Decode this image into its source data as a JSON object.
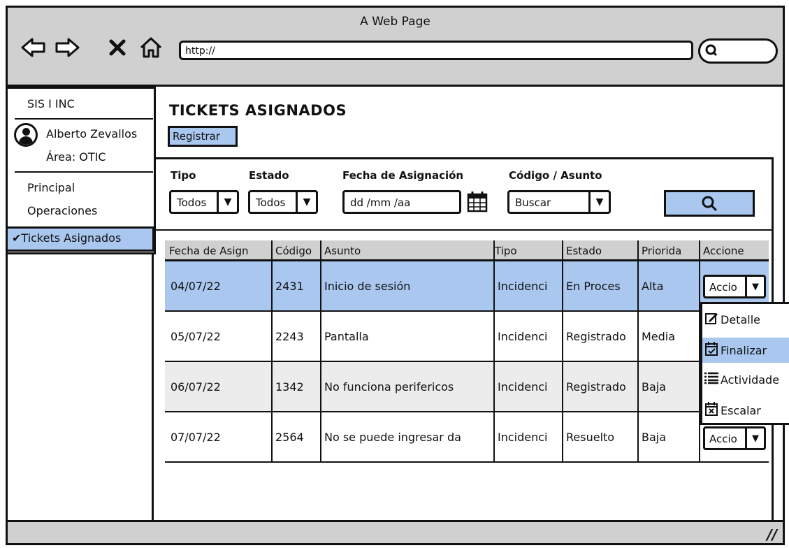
{
  "window": {
    "title": "A Web Page"
  },
  "browser": {
    "url": "http://",
    "icons": [
      "back-icon",
      "forward-icon",
      "close-icon",
      "home-icon",
      "search-icon"
    ]
  },
  "sidebar": {
    "app_name": "SIS I INC",
    "user_name": "Alberto Zevallos",
    "user_area": "Área: OTIC",
    "items": [
      {
        "label": "Principal"
      },
      {
        "label": "Operaciones"
      },
      {
        "label": "Tickets Asignados",
        "active": true
      }
    ]
  },
  "main": {
    "title": "TICKETS ASIGNADOS",
    "register_button": "Registrar",
    "filters": {
      "tipo": {
        "label": "Tipo",
        "value": "Todos"
      },
      "estado": {
        "label": "Estado",
        "value": "Todos"
      },
      "fecha": {
        "label": "Fecha de Asignación",
        "value": "dd  /mm  /aa"
      },
      "codigo": {
        "label": "Código / Asunto",
        "value": "Buscar"
      }
    },
    "table": {
      "headers": [
        "Fecha de Asign",
        "Código",
        "Asunto",
        "Tipo",
        "Estado",
        "Priorida",
        "Accione"
      ],
      "rows": [
        {
          "fecha": "04/07/22",
          "codigo": "2431",
          "asunto": "Inicio de sesión",
          "tipo": "Incidenci",
          "estado": "En Proces",
          "prioridad": "Alta",
          "accion": "Accio"
        },
        {
          "fecha": "05/07/22",
          "codigo": "2243",
          "asunto": "Pantalla",
          "tipo": "Incidenci",
          "estado": "Registrado",
          "prioridad": "Media",
          "accion": ""
        },
        {
          "fecha": "06/07/22",
          "codigo": "1342",
          "asunto": "No funciona perifericos",
          "tipo": "Incidenci",
          "estado": "Registrado",
          "prioridad": "Baja",
          "accion": ""
        },
        {
          "fecha": "07/07/22",
          "codigo": "2564",
          "asunto": "No se puede ingresar da",
          "tipo": "Incidenci",
          "estado": "Resuelto",
          "prioridad": "Baja",
          "accion": "Accio"
        }
      ]
    },
    "actions_menu": [
      {
        "label": "Detalle",
        "icon": "edit-icon"
      },
      {
        "label": "Finalizar",
        "icon": "calendar-check-icon",
        "highlighted": true
      },
      {
        "label": "Actividade",
        "icon": "list-icon"
      },
      {
        "label": "Escalar",
        "icon": "calendar-x-icon"
      }
    ]
  },
  "colors": {
    "accent": "#a9c7ef",
    "chrome": "#d0d0d0",
    "alt_row": "#ececec"
  }
}
